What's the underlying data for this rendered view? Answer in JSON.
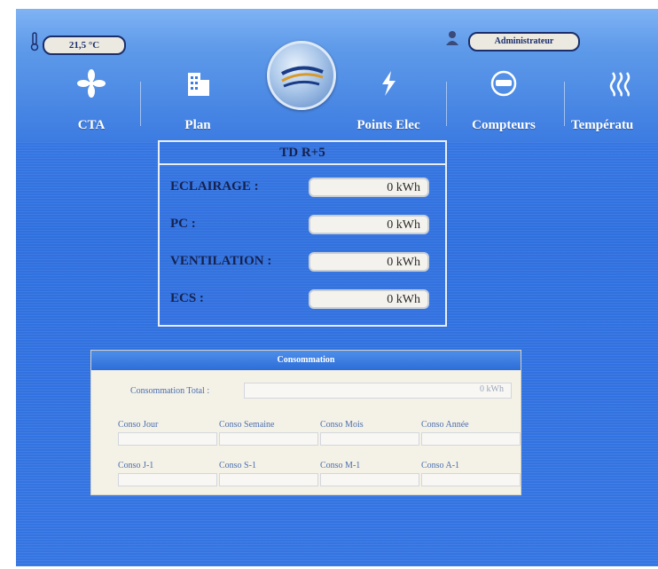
{
  "status": {
    "temperature": "21,5 °C",
    "user": "Administrateur"
  },
  "nav": {
    "items": [
      {
        "label": "CTA",
        "icon": "fan-icon"
      },
      {
        "label": "Plan",
        "icon": "building-icon"
      },
      {
        "label": "Points Elec",
        "icon": "lightning-icon"
      },
      {
        "label": "Compteurs",
        "icon": "meter-icon"
      },
      {
        "label": "Températu",
        "icon": "heat-icon"
      }
    ]
  },
  "td_panel": {
    "title": "TD R+5",
    "rows": [
      {
        "label": "ECLAIRAGE :",
        "value": "0 kWh"
      },
      {
        "label": "PC :",
        "value": "0 kWh"
      },
      {
        "label": "VENTILATION :",
        "value": "0 kWh"
      },
      {
        "label": "ECS :",
        "value": "0 kWh"
      }
    ]
  },
  "conso_panel": {
    "title": "Consommation",
    "total_label": "Consommation Total :",
    "total_value": "0 kWh",
    "current": [
      {
        "label": "Conso Jour"
      },
      {
        "label": "Conso Semaine"
      },
      {
        "label": "Conso Mois"
      },
      {
        "label": "Conso Année"
      }
    ],
    "previous": [
      {
        "label": "Conso J-1"
      },
      {
        "label": "Conso S-1"
      },
      {
        "label": "Conso M-1"
      },
      {
        "label": "Conso A-1"
      }
    ]
  },
  "colors": {
    "background": "#3575e2",
    "panel_text": "#15224f",
    "accent": "#2c6dd8"
  }
}
